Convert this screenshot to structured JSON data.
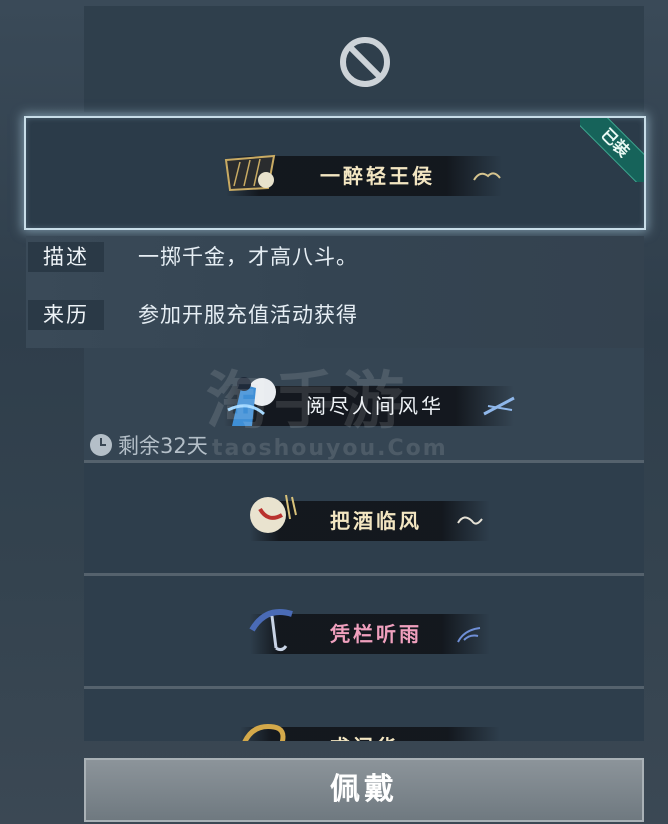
{
  "slots": {
    "equipped": {
      "name": "一醉轻王侯",
      "badge": "已装"
    },
    "items": [
      {
        "name": "阅尽人间风华"
      },
      {
        "name": "把酒临风"
      },
      {
        "name": "凭栏听雨"
      },
      {
        "name": "求问华"
      }
    ]
  },
  "info": {
    "desc_label": "描述",
    "desc_value": "一掷千金，才高八斗。",
    "source_label": "来历",
    "source_value": "参加开服充值活动获得"
  },
  "timer": {
    "text": "剩余32天"
  },
  "watermark": {
    "main": "淘手游",
    "url": "taoshouyou.Com"
  },
  "actions": {
    "wear_label": "佩戴"
  },
  "colors": {
    "frame_highlight": "#c8dde8",
    "badge_bg": "#16635a",
    "pink_title": "#f0a0be",
    "gold_title": "#f3e6c2"
  }
}
